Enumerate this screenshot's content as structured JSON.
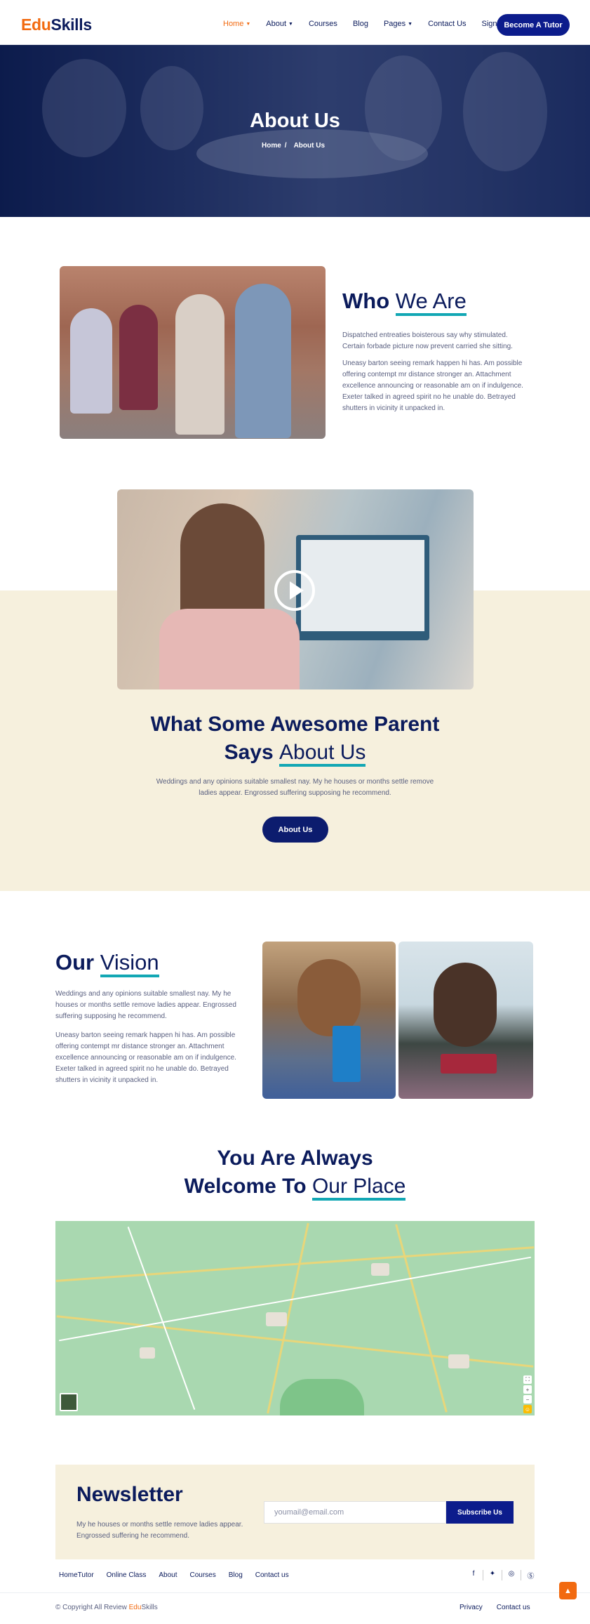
{
  "header": {
    "logo_part1": "Edu",
    "logo_part2": "Skills",
    "nav": [
      {
        "label": "Home",
        "dropdown": true,
        "active": true
      },
      {
        "label": "About",
        "dropdown": true
      },
      {
        "label": "Courses"
      },
      {
        "label": "Blog"
      },
      {
        "label": "Pages",
        "dropdown": true
      },
      {
        "label": "Contact Us"
      },
      {
        "label": "Signin"
      }
    ],
    "cta": "Become A Tutor"
  },
  "hero": {
    "title": "About Us",
    "breadcrumb_home": "Home",
    "breadcrumb_sep": "/",
    "breadcrumb_current": "About Us"
  },
  "who": {
    "title_plain": "Who ",
    "title_underlined": "We Are",
    "para1": "Dispatched entreaties boisterous say why stimulated. Certain forbade picture now prevent carried she sitting.",
    "para2": "Uneasy barton seeing remark happen hi has. Am possible offering contempt mr distance stronger an. Attachment excellence announcing or reasonable am on if indulgence. Exeter talked in agreed spirit no he unable do. Betrayed shutters in vicinity it unpacked in."
  },
  "parents": {
    "title_line1": "What Some Awesome Parent",
    "title_plain2": "Says ",
    "title_underlined": "About Us",
    "para": "Weddings and any opinions suitable smallest nay. My he houses or months settle remove ladies appear. Engrossed suffering supposing he recommend.",
    "button": "About Us"
  },
  "vision": {
    "title_plain": "Our ",
    "title_underlined": "Vision",
    "para1": "Weddings and any opinions suitable smallest nay. My he houses or months settle remove ladies appear. Engrossed suffering supposing he recommend.",
    "para2": "Uneasy barton seeing remark happen hi has. Am possible offering contempt mr distance stronger an. Attachment excellence announcing or reasonable am on if indulgence. Exeter talked in agreed spirit no he unable do. Betrayed shutters in vicinity it unpacked in."
  },
  "welcome": {
    "title_line1": "You Are Always",
    "title_plain2": "Welcome To ",
    "title_underlined": "Our Place"
  },
  "newsletter": {
    "title": "Newsletter",
    "text": "My he houses or months settle remove ladies appear. Engrossed suffering he recommend.",
    "placeholder": "youmail@email.com",
    "button": "Subscribe Us"
  },
  "footer": {
    "links": [
      "HomeTutor",
      "Online Class",
      "About",
      "Courses",
      "Blog",
      "Contact us"
    ],
    "social": [
      "facebook-icon",
      "twitter-icon",
      "instagram-icon",
      "skype-icon"
    ],
    "copyright_prefix": "© Copyright All Review ",
    "copyright_brand1": "Edu",
    "copyright_brand2": "Skills",
    "right_links": [
      "Privacy",
      "Contact us"
    ]
  },
  "colors": {
    "brand_orange": "#f26a10",
    "navy": "#0b1b5c",
    "button_blue": "#0c1c8c",
    "accent_teal": "#12a7b4",
    "beige": "#f6f0dd"
  }
}
